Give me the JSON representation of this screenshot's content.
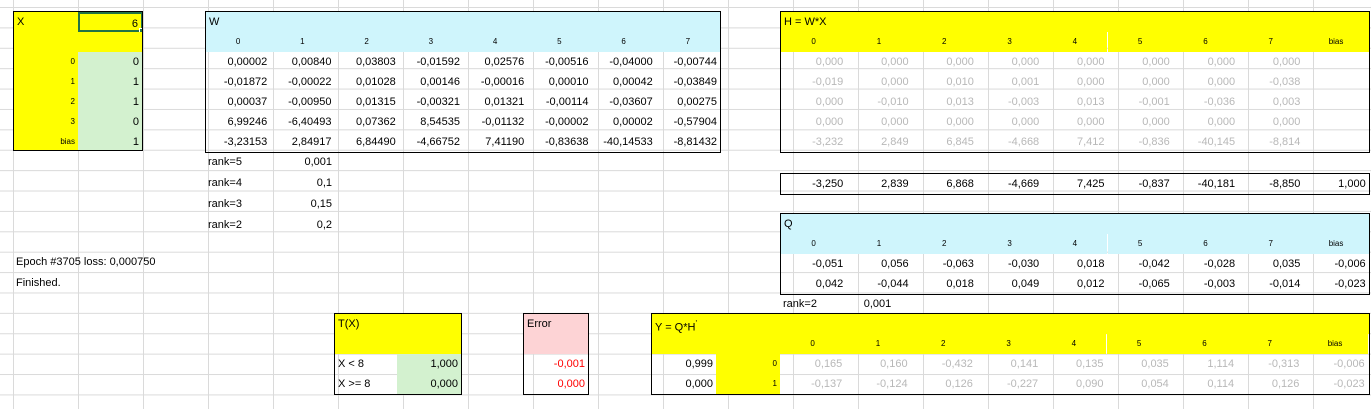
{
  "x_block": {
    "label": "X",
    "value": "6",
    "rows": [
      {
        "label": "0",
        "value": "0"
      },
      {
        "label": "1",
        "value": "1"
      },
      {
        "label": "2",
        "value": "1"
      },
      {
        "label": "3",
        "value": "0"
      },
      {
        "label": "bias",
        "value": "1"
      }
    ]
  },
  "w_block": {
    "title": "W",
    "headers": [
      "0",
      "1",
      "2",
      "3",
      "4",
      "5",
      "6",
      "7"
    ],
    "rows": [
      [
        "0,00002",
        "0,00840",
        "0,03803",
        "-0,01592",
        "0,02576",
        "-0,00516",
        "-0,04000",
        "-0,00744"
      ],
      [
        "-0,01872",
        "-0,00022",
        "0,01028",
        "0,00146",
        "-0,00016",
        "0,00010",
        "0,00042",
        "-0,03849"
      ],
      [
        "0,00037",
        "-0,00950",
        "0,01315",
        "-0,00321",
        "0,01321",
        "-0,00114",
        "-0,03607",
        "0,00275"
      ],
      [
        "6,99246",
        "-6,40493",
        "0,07362",
        "8,54535",
        "-0,01132",
        "-0,00002",
        "0,00002",
        "-0,57904"
      ],
      [
        "-3,23153",
        "2,84917",
        "6,84490",
        "-4,66752",
        "7,41190",
        "-0,83638",
        "-40,14533",
        "-8,81432"
      ]
    ],
    "ranks": [
      {
        "label": "rank=5",
        "value": "0,001"
      },
      {
        "label": "rank=4",
        "value": "0,1"
      },
      {
        "label": "rank=3",
        "value": "0,15"
      },
      {
        "label": "rank=2",
        "value": "0,2"
      }
    ]
  },
  "status": {
    "epoch": "Epoch #3705 loss: 0,000750",
    "finished": "Finished."
  },
  "h_block": {
    "title": "H = W*X",
    "headers": [
      "0",
      "1",
      "2",
      "3",
      "4",
      "5",
      "6",
      "7",
      "bias"
    ],
    "rows": [
      [
        "0,000",
        "0,000",
        "0,000",
        "0,000",
        "0,000",
        "0,000",
        "0,000",
        "0,000"
      ],
      [
        "-0,019",
        "0,000",
        "0,010",
        "0,001",
        "0,000",
        "0,000",
        "0,000",
        "-0,038"
      ],
      [
        "0,000",
        "-0,010",
        "0,013",
        "-0,003",
        "0,013",
        "-0,001",
        "-0,036",
        "0,003"
      ],
      [
        "0,000",
        "0,000",
        "0,000",
        "0,000",
        "0,000",
        "0,000",
        "0,000",
        "0,000"
      ],
      [
        "-3,232",
        "2,849",
        "6,845",
        "-4,668",
        "7,412",
        "-0,836",
        "-40,145",
        "-8,814"
      ]
    ],
    "sum_row": [
      "-3,250",
      "2,839",
      "6,868",
      "-4,669",
      "7,425",
      "-0,837",
      "-40,181",
      "-8,850",
      "1,000"
    ]
  },
  "q_block": {
    "title": "Q",
    "headers": [
      "0",
      "1",
      "2",
      "3",
      "4",
      "5",
      "6",
      "7",
      "bias"
    ],
    "rows": [
      [
        "-0,051",
        "0,056",
        "-0,063",
        "-0,030",
        "0,018",
        "-0,042",
        "-0,028",
        "0,035",
        "-0,006"
      ],
      [
        "0,042",
        "-0,044",
        "0,018",
        "0,049",
        "0,012",
        "-0,065",
        "-0,003",
        "-0,014",
        "-0,023"
      ]
    ],
    "rank": {
      "label": "rank=2",
      "value": "0,001"
    }
  },
  "t_block": {
    "title": "T(X)",
    "rows": [
      {
        "label": "X < 8",
        "value": "1,000"
      },
      {
        "label": "X >= 8",
        "value": "0,000"
      }
    ]
  },
  "error_block": {
    "title": "Error",
    "values": [
      "-0,001",
      "0,000"
    ]
  },
  "y_block": {
    "title": "Y = Q*H",
    "headers": [
      "0",
      "1",
      "2",
      "3",
      "4",
      "5",
      "6",
      "7",
      "bias"
    ],
    "left_values": [
      "0,999",
      "0,000"
    ],
    "row_labels": [
      "0",
      "1"
    ],
    "rows": [
      [
        "0,165",
        "0,160",
        "-0,432",
        "0,141",
        "0,135",
        "0,035",
        "1,114",
        "-0,313",
        "-0,006"
      ],
      [
        "-0,137",
        "-0,124",
        "0,126",
        "-0,227",
        "0,090",
        "0,054",
        "0,114",
        "0,126",
        "-0,023"
      ]
    ]
  }
}
